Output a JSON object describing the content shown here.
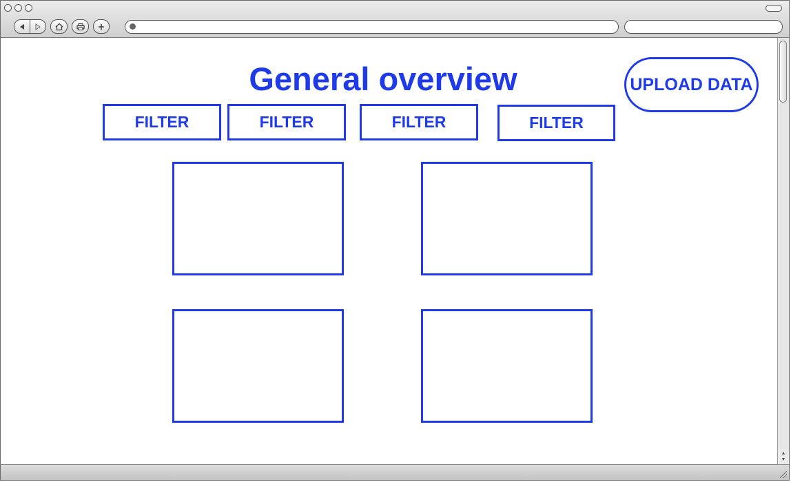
{
  "page": {
    "title": "General overview",
    "upload_label": "UPLOAD DATA"
  },
  "filters": [
    {
      "label": "FILTER"
    },
    {
      "label": "FILTER"
    },
    {
      "label": "FILTER"
    },
    {
      "label": "FILTER"
    }
  ],
  "icons": {
    "back": "back-arrow-icon",
    "forward": "forward-arrow-icon",
    "home": "home-icon",
    "print": "print-icon",
    "add": "plus-icon",
    "globe": "globe-icon"
  },
  "colors": {
    "accent": "#1f3be8"
  }
}
